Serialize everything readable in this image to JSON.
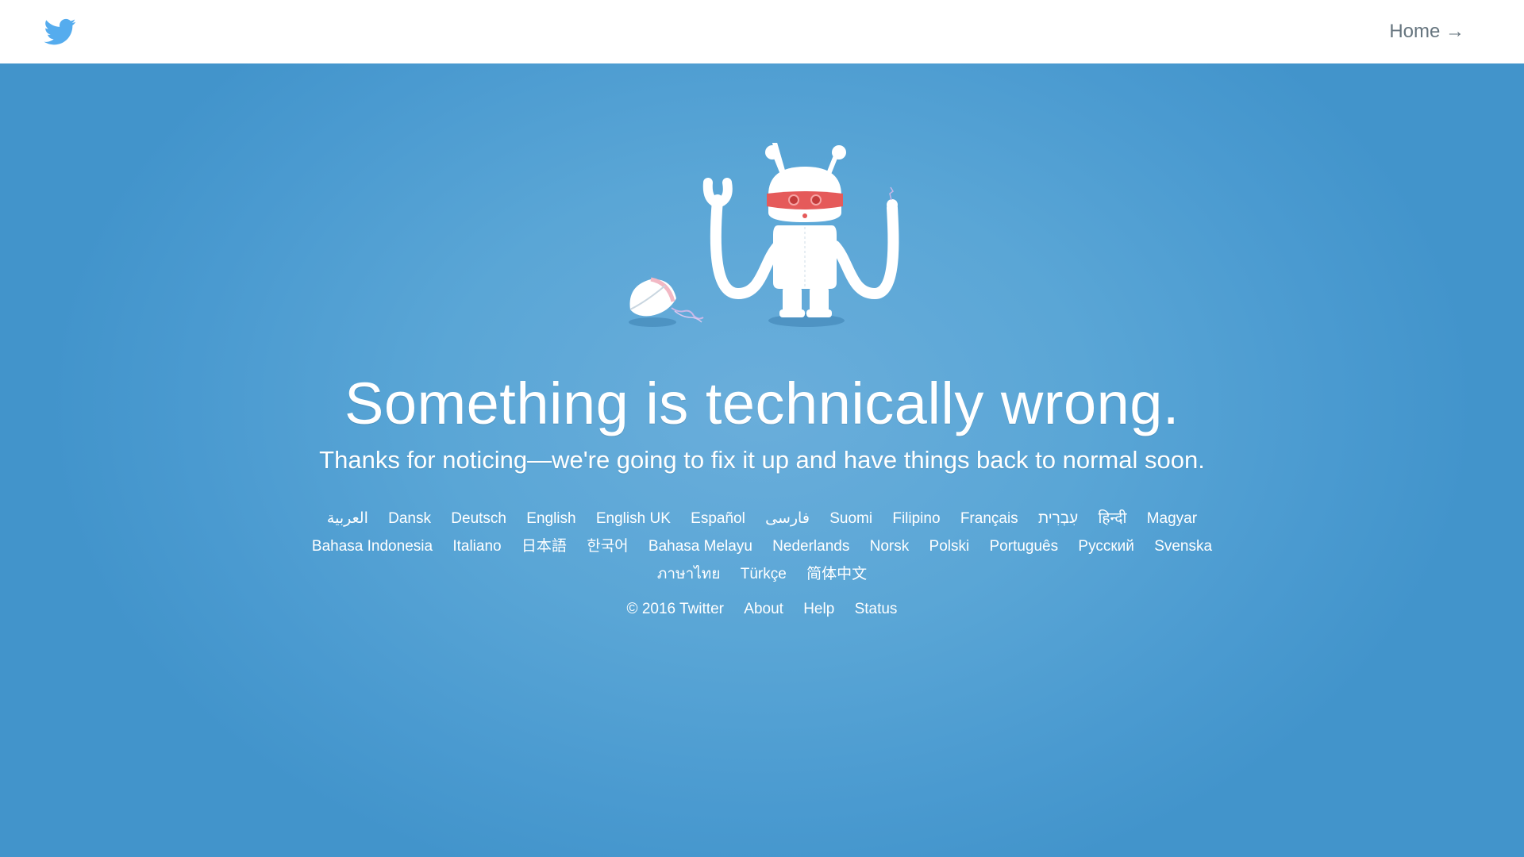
{
  "header": {
    "logo_icon": "twitter-bird-icon",
    "home_label": "Home →"
  },
  "main": {
    "title": "Something is technically wrong.",
    "subtitle": "Thanks for noticing—we're going to fix it up and have things back to normal soon.",
    "illustration": "broken-robot-illustration"
  },
  "languages": [
    "العربية",
    "Dansk",
    "Deutsch",
    "English",
    "English UK",
    "Español",
    "فارسی",
    "Suomi",
    "Filipino",
    "Français",
    "עִבְרִית",
    "हिन्दी",
    "Magyar",
    "Bahasa Indonesia",
    "Italiano",
    "日本語",
    "한국어",
    "Bahasa Melayu",
    "Nederlands",
    "Norsk",
    "Polski",
    "Português",
    "Русский",
    "Svenska",
    "ภาษาไทย",
    "Türkçe",
    "简体中文"
  ],
  "footer": {
    "copyright": "© 2016 Twitter",
    "about": "About",
    "help": "Help",
    "status": "Status"
  },
  "colors": {
    "brand": "#55acee",
    "background": "#5aa6d6",
    "text_on_blue": "#ffffff",
    "header_link": "#66757f",
    "robot_visor": "#e55a5a"
  }
}
